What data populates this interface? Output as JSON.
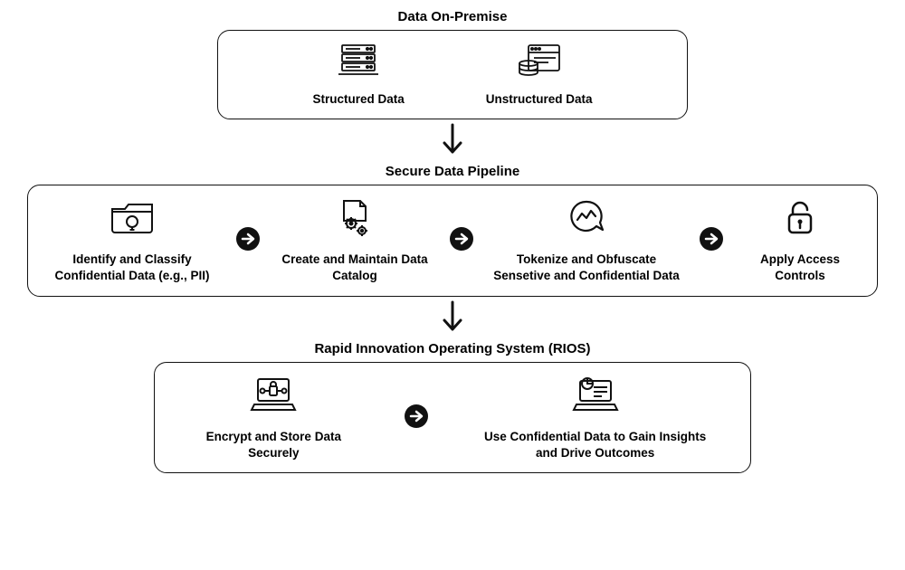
{
  "section1": {
    "title": "Data On-Premise",
    "items": [
      {
        "label": "Structured Data"
      },
      {
        "label": "Unstructured Data"
      }
    ]
  },
  "section2": {
    "title": "Secure Data Pipeline",
    "items": [
      {
        "label": "Identify and Classify Confidential Data (e.g., PII)"
      },
      {
        "label": "Create and Maintain Data Catalog"
      },
      {
        "label": "Tokenize and Obfuscate Sensetive and Confidential Data"
      },
      {
        "label": "Apply Access Controls"
      }
    ]
  },
  "section3": {
    "title": "Rapid Innovation Operating System (RIOS)",
    "items": [
      {
        "label": "Encrypt and Store Data Securely"
      },
      {
        "label": "Use Confidential Data to Gain Insights and Drive Outcomes"
      }
    ]
  }
}
